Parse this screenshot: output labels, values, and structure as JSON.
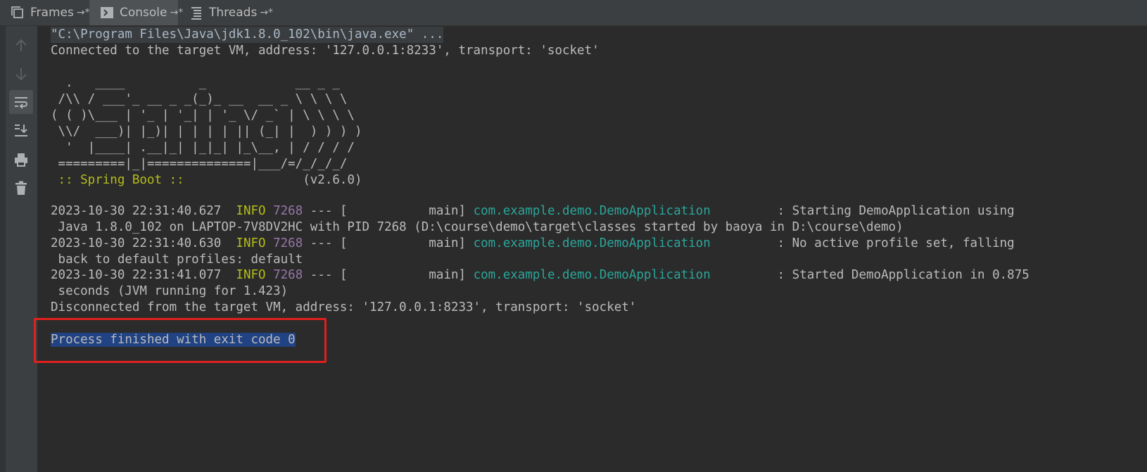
{
  "tabs": [
    {
      "label": "Frames",
      "pin": "→*",
      "icon": "frames-icon"
    },
    {
      "label": "Console",
      "pin": "→*",
      "icon": "console-icon",
      "active": true
    },
    {
      "label": "Threads",
      "pin": "→*",
      "icon": "threads-icon"
    }
  ],
  "toolbar": {
    "icons": [
      "up-arrow-icon",
      "down-arrow-icon",
      "soft-wrap-icon",
      "scroll-to-end-icon",
      "print-icon",
      "trash-icon"
    ]
  },
  "console": {
    "command": "\"C:\\Program Files\\Java\\jdk1.8.0_102\\bin\\java.exe\" ...",
    "connected": "Connected to the target VM, address: '127.0.0.1:8233', transport: 'socket'",
    "banner": [
      "  .   ____          _            __ _ _",
      " /\\\\ / ___'_ __ _ _(_)_ __  __ _ \\ \\ \\ \\",
      "( ( )\\___ | '_ | '_| | '_ \\/ _` | \\ \\ \\ \\",
      " \\\\/  ___)| |_)| | | | | || (_| |  ) ) ) )",
      "  '  |____| .__|_| |_|_| |_\\__, | / / / /",
      " =========|_|==============|___/=/_/_/_/"
    ],
    "spring_label": " :: Spring Boot :: ",
    "spring_version": "               (v2.6.0)",
    "logs": [
      {
        "timestamp": "2023-10-30 22:31:40.627",
        "level": "INFO",
        "pid": "7268",
        "thread": " --- [           main] ",
        "logger": "com.example.demo.DemoApplication",
        "message": "         : Starting DemoApplication using",
        "cont": " Java 1.8.0_102 on LAPTOP-7V8DV2HC with PID 7268 (D:\\course\\demo\\target\\classes started by baoya in D:\\course\\demo)"
      },
      {
        "timestamp": "2023-10-30 22:31:40.630",
        "level": "INFO",
        "pid": "7268",
        "thread": " --- [           main] ",
        "logger": "com.example.demo.DemoApplication",
        "message": "         : No active profile set, falling",
        "cont": " back to default profiles: default"
      },
      {
        "timestamp": "2023-10-30 22:31:41.077",
        "level": "INFO",
        "pid": "7268",
        "thread": " --- [           main] ",
        "logger": "com.example.demo.DemoApplication",
        "message": "         : Started DemoApplication in 0.875",
        "cont": " seconds (JVM running for 1.423)"
      }
    ],
    "disconnected": "Disconnected from the target VM, address: '127.0.0.1:8233', transport: 'socket'",
    "exit_message": "Process finished with exit code 0"
  },
  "colors": {
    "background": "#2b2b2b",
    "spring_green": "#b5bd18",
    "logger_teal": "#2aa69a",
    "pid_purple": "#9876aa",
    "selection": "#214283",
    "highlight_box": "#e0201e"
  }
}
